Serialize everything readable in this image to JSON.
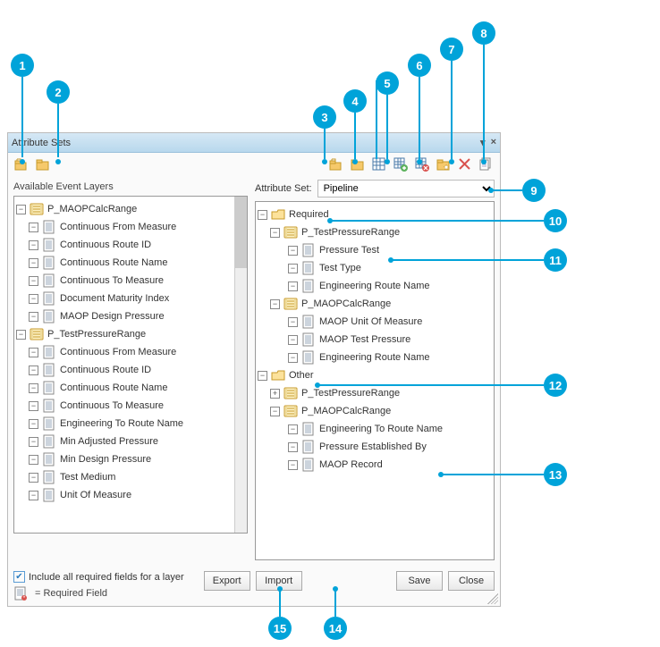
{
  "dialog": {
    "title": "Attribute Sets"
  },
  "left": {
    "label": "Available Event Layers",
    "checkbox": "Include all required fields for a layer",
    "req_legend": "= Required Field",
    "tree": {
      "g1": "P_MAOPCalcRange",
      "g1_items": [
        "Continuous From Measure",
        "Continuous Route ID",
        "Continuous Route Name",
        "Continuous To Measure",
        "Document Maturity Index",
        "MAOP Design Pressure"
      ],
      "g2": "P_TestPressureRange",
      "g2_items": [
        "Continuous From Measure",
        "Continuous Route ID",
        "Continuous Route Name",
        "Continuous To Measure",
        "Engineering To Route Name",
        "Min Adjusted Pressure",
        "Min Design Pressure",
        "Test Medium",
        "Unit Of Measure"
      ]
    }
  },
  "right": {
    "attrset_label": "Attribute Set:",
    "attrset_value": "Pipeline",
    "tree": {
      "folder1": "Required",
      "f1_g1": "P_TestPressureRange",
      "f1_g1_items": [
        "Pressure Test",
        "Test Type",
        "Engineering Route Name"
      ],
      "f1_g2": "P_MAOPCalcRange",
      "f1_g2_items": [
        "MAOP Unit Of Measure",
        "MAOP Test Pressure",
        "Engineering Route Name"
      ],
      "folder2": "Other",
      "f2_g1": "P_TestPressureRange",
      "f2_g2": "P_MAOPCalcRange",
      "f2_g2_items": [
        "Engineering To Route Name",
        "Pressure Established By",
        "MAOP Record"
      ]
    }
  },
  "buttons": {
    "export": "Export",
    "import": "Import",
    "save": "Save",
    "close": "Close"
  },
  "callouts": [
    "1",
    "2",
    "3",
    "4",
    "5",
    "6",
    "7",
    "8",
    "9",
    "10",
    "11",
    "12",
    "13",
    "14",
    "15"
  ]
}
